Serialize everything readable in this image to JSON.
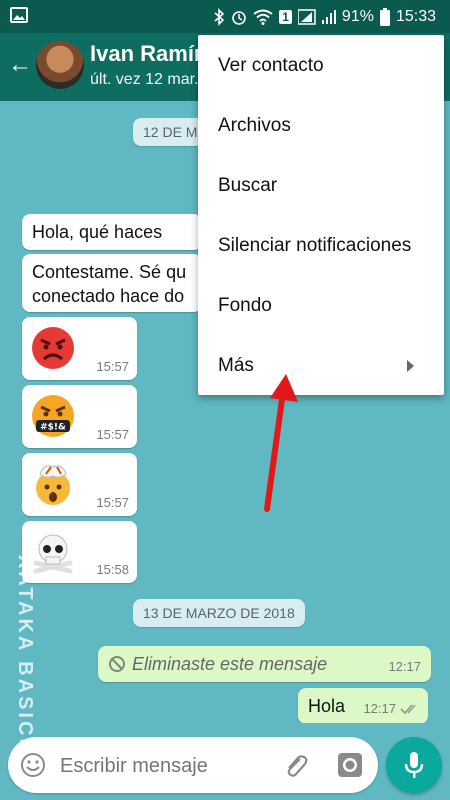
{
  "status_bar": {
    "battery": "91%",
    "time": "15:33",
    "sim_badge": "1"
  },
  "header": {
    "contact_name": "Ivan Ramíre",
    "status": "últ. vez 12 mar."
  },
  "chat": {
    "date_top": "12 DE M",
    "date_bottom": "13 DE MARZO DE 2018",
    "incoming": [
      {
        "text": "Hola, qué haces",
        "time": ""
      },
      {
        "text": "Contestame. Sé qu\nconectado hace do",
        "time": ""
      },
      {
        "emoji": "angry-face",
        "time": "15:57"
      },
      {
        "emoji": "cursing-face",
        "time": "15:57"
      },
      {
        "emoji": "exploding-head",
        "time": "15:57"
      },
      {
        "emoji": "skull-crossbones",
        "time": "15:58"
      }
    ],
    "outgoing": [
      {
        "text": "Eliminaste este mensaje",
        "time": "12:17",
        "deleted": true
      },
      {
        "text": "Hola",
        "time": "12:17",
        "ticks": "double"
      }
    ]
  },
  "composer": {
    "placeholder": "Escribir mensaje"
  },
  "overflow_menu": {
    "items": [
      {
        "label": "Ver contacto"
      },
      {
        "label": "Archivos"
      },
      {
        "label": "Buscar"
      },
      {
        "label": "Silenciar notificaciones"
      },
      {
        "label": "Fondo"
      },
      {
        "label": "Más",
        "has_submenu": true
      }
    ]
  },
  "watermark": "XATAKA BASICS",
  "colors": {
    "header": "#0f6c61",
    "accent": "#0aa89e",
    "outgoing_bubble": "#dcf8c6",
    "annotation_arrow": "#e11919"
  }
}
